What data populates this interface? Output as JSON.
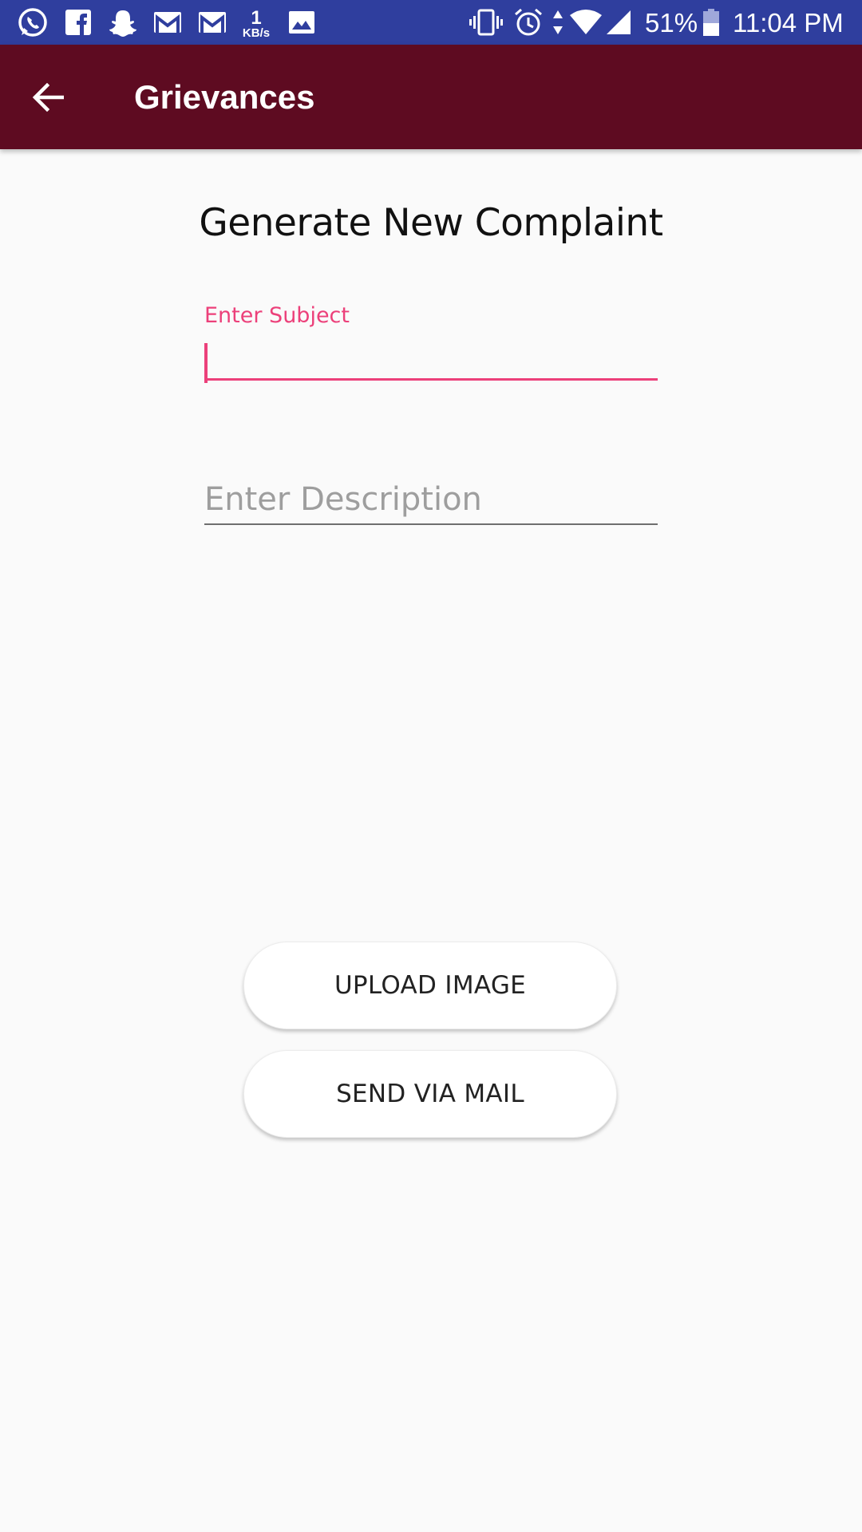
{
  "status_bar": {
    "notification_icons": [
      "whatsapp-icon",
      "facebook-icon",
      "snapchat-icon",
      "gmail-icon",
      "gmail-icon",
      "network-speed-icon",
      "gallery-icon"
    ],
    "network_speed_value": "1",
    "network_speed_unit": "KB/s",
    "system_icons": [
      "vibrate-icon",
      "alarm-icon",
      "data-arrows-icon",
      "wifi-icon",
      "cell-signal-icon",
      "battery-icon"
    ],
    "battery_percent": "51%",
    "time": "11:04 PM",
    "background_color": "#2f3e9e"
  },
  "app_bar": {
    "title": "Grievances",
    "back_icon": "arrow-left-icon",
    "background_color": "#5e0b21"
  },
  "form": {
    "heading": "Generate New Complaint",
    "subject": {
      "label": "Enter Subject",
      "value": "",
      "focused": true,
      "accent_color": "#ec407a"
    },
    "description": {
      "placeholder": "Enter Description",
      "value": ""
    }
  },
  "actions": {
    "upload_label": "UPLOAD IMAGE",
    "send_label": "SEND VIA MAIL"
  }
}
